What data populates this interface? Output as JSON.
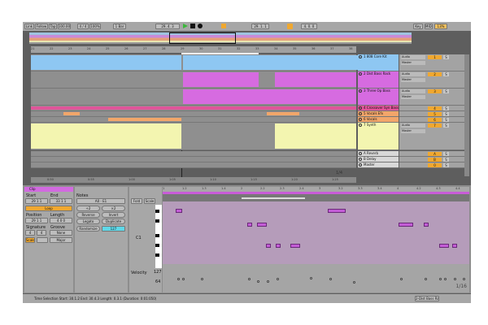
{
  "control_bar": {
    "link": "Link",
    "follow": "Follow",
    "tap": "Tap",
    "tempo": "100.00",
    "signature": "4 / 4",
    "zoom": "100%",
    "quantize": "1 Bar",
    "position": "29. 4. 3",
    "loop_start": "29. 1. 1",
    "loop_length": "4. 0. 0",
    "key": "Key",
    "midi": "MIDI",
    "cpu": "13%"
  },
  "bar_ruler": [
    "21",
    "22",
    "23",
    "24",
    "25",
    "26",
    "27",
    "28",
    "29",
    "30",
    "31",
    "32",
    "33",
    "34",
    "35",
    "36",
    "37",
    "38"
  ],
  "time_ruler": [
    "0:50",
    "0:55",
    "1:00",
    "1:05",
    "1:10",
    "1:15",
    "1:20",
    "1:25"
  ],
  "arrangement_page": "1/4",
  "tracks": [
    {
      "name": "1 808 Core Kit",
      "number": "1",
      "input": "Audio",
      "output": "Master",
      "color": "#8ec7f2"
    },
    {
      "name": "2 Dist Bass Rack",
      "number": "2",
      "input": "Audio",
      "output": "Master",
      "color": "#d66be0"
    },
    {
      "name": "3 Three Op Bass",
      "number": "3",
      "input": "Audio",
      "output": "Master",
      "color": "#d66be0"
    },
    {
      "name": "4 Crossover Syn Bass",
      "number": "4",
      "color": "#e0559a"
    },
    {
      "name": "5 Vocals Efx",
      "number": "5",
      "color": "#f2a66a"
    },
    {
      "name": "6 Vocals",
      "number": "6",
      "color": "#f2a66a"
    },
    {
      "name": "7 Synth",
      "number": "7",
      "input": "Audio",
      "output": "Master",
      "color": "#f3f5b0"
    },
    {
      "name": "A Reverb",
      "number": "A",
      "color": "#d8d8d8"
    },
    {
      "name": "B Delay",
      "number": "B",
      "color": "#d8d8d8"
    },
    {
      "name": "Master",
      "number": "0",
      "color": "#d8d8d8"
    }
  ],
  "clip_view": {
    "title": "Clip",
    "start_label": "Start",
    "end_label": "End",
    "start": "29  1  1",
    "end": "33  1  1",
    "loop": "Loop",
    "position_label": "Position",
    "length_label": "Length",
    "position": "29  1  1",
    "length": "4  0  0",
    "signature_label": "Signature",
    "groove_label": "Groove",
    "sig_num": "4",
    "sig_den": "4",
    "groove": "None",
    "scale": "Scale",
    "scale_name": "Major",
    "notes_label": "Notes",
    "notes_range": "A0 - E1",
    "half": "÷2",
    "double": "×2",
    "reverse": "Reverse",
    "invert": "Invert",
    "legato": "Legato",
    "duplicate": "Duplicate",
    "randomize": "Randomize",
    "velocity_value": "127",
    "fold": "Fold",
    "scale_btn": "Scale",
    "pitch_label": "C1",
    "velocity_label": "Velocity",
    "vel_max": "127",
    "vel_mid": "64",
    "grid": "1/16",
    "ruler": [
      "1",
      "1.2",
      "1.3",
      "1.4",
      "2",
      "2.2",
      "2.3",
      "2.4",
      "3",
      "3.2",
      "3.3",
      "3.4",
      "4",
      "4.2",
      "4.3",
      "4.4"
    ]
  },
  "status_bar": {
    "text": "Time Selection   Start: 30.1.2   End: 30.4.3   Length: 0.3.1   (Duration: 0:01:050)",
    "track": "2-Dist Bass Rack"
  }
}
